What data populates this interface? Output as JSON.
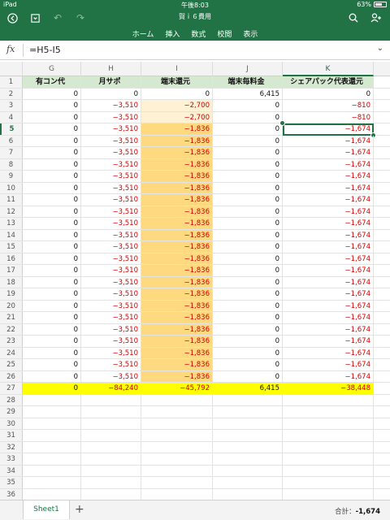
{
  "status_bar": {
    "device": "iPad",
    "time": "午後8:03",
    "battery": "63%"
  },
  "title_bar": {
    "doc_title": "賀ｉ６費用"
  },
  "ribbon": {
    "tabs": [
      "ホーム",
      "挿入",
      "数式",
      "校閲",
      "表示"
    ]
  },
  "formula_bar": {
    "fx": "fx",
    "value": "=H5-I5"
  },
  "grid": {
    "columns": [
      "G",
      "H",
      "I",
      "J",
      "K"
    ],
    "active_column": "K",
    "headers": [
      "有コン代",
      "月サポ",
      "端末還元",
      "端末毎料金",
      "シェアパック代表還元"
    ],
    "rows": [
      {
        "n": "2",
        "g": "0",
        "h": "0",
        "i": "0",
        "j": "6,415",
        "k": "0"
      },
      {
        "n": "3",
        "g": "0",
        "h": "−3,510",
        "i": "−2,700",
        "j": "0",
        "k": "−810"
      },
      {
        "n": "4",
        "g": "0",
        "h": "−3,510",
        "i": "−2,700",
        "j": "0",
        "k": "−810"
      },
      {
        "n": "5",
        "g": "0",
        "h": "−3,510",
        "i": "−1,836",
        "j": "0",
        "k": "−1,674"
      },
      {
        "n": "6",
        "g": "0",
        "h": "−3,510",
        "i": "−1,836",
        "j": "0",
        "k": "−1,674"
      },
      {
        "n": "7",
        "g": "0",
        "h": "−3,510",
        "i": "−1,836",
        "j": "0",
        "k": "−1,674"
      },
      {
        "n": "8",
        "g": "0",
        "h": "−3,510",
        "i": "−1,836",
        "j": "0",
        "k": "−1,674"
      },
      {
        "n": "9",
        "g": "0",
        "h": "−3,510",
        "i": "−1,836",
        "j": "0",
        "k": "−1,674"
      },
      {
        "n": "10",
        "g": "0",
        "h": "−3,510",
        "i": "−1,836",
        "j": "0",
        "k": "−1,674"
      },
      {
        "n": "11",
        "g": "0",
        "h": "−3,510",
        "i": "−1,836",
        "j": "0",
        "k": "−1,674"
      },
      {
        "n": "12",
        "g": "0",
        "h": "−3,510",
        "i": "−1,836",
        "j": "0",
        "k": "−1,674"
      },
      {
        "n": "13",
        "g": "0",
        "h": "−3,510",
        "i": "−1,836",
        "j": "0",
        "k": "−1,674"
      },
      {
        "n": "14",
        "g": "0",
        "h": "−3,510",
        "i": "−1,836",
        "j": "0",
        "k": "−1,674"
      },
      {
        "n": "15",
        "g": "0",
        "h": "−3,510",
        "i": "−1,836",
        "j": "0",
        "k": "−1,674"
      },
      {
        "n": "16",
        "g": "0",
        "h": "−3,510",
        "i": "−1,836",
        "j": "0",
        "k": "−1,674"
      },
      {
        "n": "17",
        "g": "0",
        "h": "−3,510",
        "i": "−1,836",
        "j": "0",
        "k": "−1,674"
      },
      {
        "n": "18",
        "g": "0",
        "h": "−3,510",
        "i": "−1,836",
        "j": "0",
        "k": "−1,674"
      },
      {
        "n": "19",
        "g": "0",
        "h": "−3,510",
        "i": "−1,836",
        "j": "0",
        "k": "−1,674"
      },
      {
        "n": "20",
        "g": "0",
        "h": "−3,510",
        "i": "−1,836",
        "j": "0",
        "k": "−1,674"
      },
      {
        "n": "21",
        "g": "0",
        "h": "−3,510",
        "i": "−1,836",
        "j": "0",
        "k": "−1,674"
      },
      {
        "n": "22",
        "g": "0",
        "h": "−3,510",
        "i": "−1,836",
        "j": "0",
        "k": "−1,674"
      },
      {
        "n": "23",
        "g": "0",
        "h": "−3,510",
        "i": "−1,836",
        "j": "0",
        "k": "−1,674"
      },
      {
        "n": "24",
        "g": "0",
        "h": "−3,510",
        "i": "−1,836",
        "j": "0",
        "k": "−1,674"
      },
      {
        "n": "25",
        "g": "0",
        "h": "−3,510",
        "i": "−1,836",
        "j": "0",
        "k": "−1,674"
      },
      {
        "n": "26",
        "g": "0",
        "h": "−3,510",
        "i": "−1,836",
        "j": "0",
        "k": "−1,674"
      }
    ],
    "total_row": {
      "n": "27",
      "g": "0",
      "h": "−84,240",
      "i": "−45,792",
      "j": "6,415",
      "k": "−38,448"
    },
    "empty_rows": [
      "28",
      "29",
      "30",
      "31",
      "32",
      "33",
      "34",
      "35",
      "36"
    ],
    "selected_cell": "K5"
  },
  "sheet_bar": {
    "sheet_name": "Sheet1",
    "add_label": "+",
    "sum_label": "合計：",
    "sum_value": "-1,674"
  },
  "colors": {
    "excel_green": "#217346",
    "header_fill": "#d5e8d0",
    "orange_fill": "#ffd97f",
    "light_orange_fill": "#fff1d3",
    "total_fill": "#ffff00",
    "negative_text": "#d20000"
  }
}
